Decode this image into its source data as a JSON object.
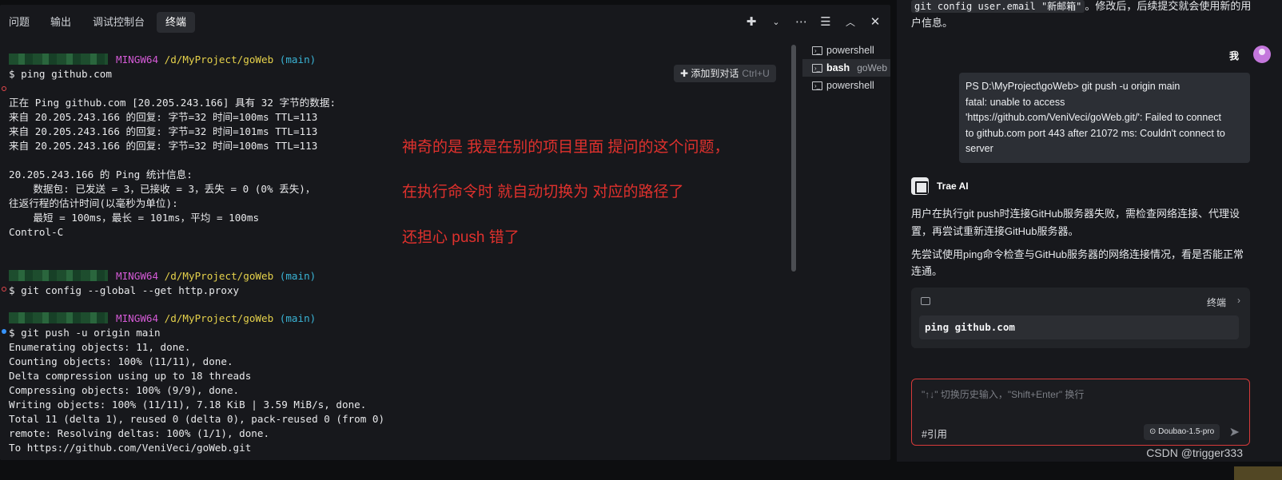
{
  "panel_tabs": [
    "问题",
    "输出",
    "调试控制台",
    "终端"
  ],
  "terminal": {
    "prompt1": {
      "host": "MINGW64",
      "path": "/d/MyProject/goWeb",
      "branch": "(main)"
    },
    "cmd1": "$ ping github.com",
    "ping_lines": [
      "正在 Ping github.com [20.205.243.166] 具有 32 字节的数据:",
      "来自 20.205.243.166 的回复: 字节=32 时间=100ms TTL=113",
      "来自 20.205.243.166 的回复: 字节=32 时间=101ms TTL=113",
      "来自 20.205.243.166 的回复: 字节=32 时间=100ms TTL=113",
      "",
      "20.205.243.166 的 Ping 统计信息:",
      "    数据包: 已发送 = 3，已接收 = 3，丢失 = 0 (0% 丢失)，",
      "往返行程的估计时间(以毫秒为单位):",
      "    最短 = 100ms，最长 = 101ms，平均 = 100ms",
      "Control-C"
    ],
    "prompt2": {
      "host": "MINGW64",
      "path": "/d/MyProject/goWeb",
      "branch": "(main)"
    },
    "cmd2": "$ git config --global --get http.proxy",
    "prompt3": {
      "host": "MINGW64",
      "path": "/d/MyProject/goWeb",
      "branch": "(main)"
    },
    "cmd3": "$ git push -u origin main",
    "push_lines": [
      "Enumerating objects: 11, done.",
      "Counting objects: 100% (11/11), done.",
      "Delta compression using up to 18 threads",
      "Compressing objects: 100% (9/9), done.",
      "Writing objects: 100% (11/11), 7.18 KiB | 3.59 MiB/s, done.",
      "Total 11 (delta 1), reused 0 (delta 0), pack-reused 0 (from 0)",
      "remote: Resolving deltas: 100% (1/1), done.",
      "To https://github.com/VeniVeci/goWeb.git"
    ]
  },
  "add_to_chat": {
    "label": "添加到对话",
    "shortcut": "Ctrl+U"
  },
  "annotations": [
    "神奇的是  我是在别的项目里面 提问的这个问题，",
    "在执行命令时 就自动切换为 对应的路径了",
    "还担心 push 错了"
  ],
  "terminal_list": [
    {
      "name": "powershell",
      "sub": ""
    },
    {
      "name": "bash",
      "sub": "goWeb"
    },
    {
      "name": "powershell",
      "sub": ""
    }
  ],
  "chat": {
    "top_code": "git config user.email \"新邮箱\"",
    "top_text_1": "。修改后，后续提交就会使用新的用",
    "top_text_2": "户信息。",
    "me": "我",
    "user_message": [
      "PS D:\\MyProject\\goWeb> git push -u origin main",
      "fatal: unable to access",
      "'https://github.com/VeniVeci/goWeb.git/': Failed to connect",
      "to github.com port 443 after 21072 ms: Couldn't connect to",
      "server"
    ],
    "ai_name": "Trae AI",
    "ai_text_1": "用户在执行git push时连接GitHub服务器失败，需检查网络连接、代理设",
    "ai_text_2": "置，再尝试重新连接GitHub服务器。",
    "ai_text_3": "先尝试使用ping命令检查与GitHub服务器的网络连接情况，看是否能正常",
    "ai_text_4": "连通。",
    "cmd_card_label": "终端",
    "cmd_card_code": "ping github.com",
    "input_placeholder": "\"↑↓\" 切换历史输入，\"Shift+Enter\" 换行",
    "ref_label": "#引用",
    "model": "Doubao-1.5-pro"
  },
  "watermark": "CSDN @trigger333"
}
